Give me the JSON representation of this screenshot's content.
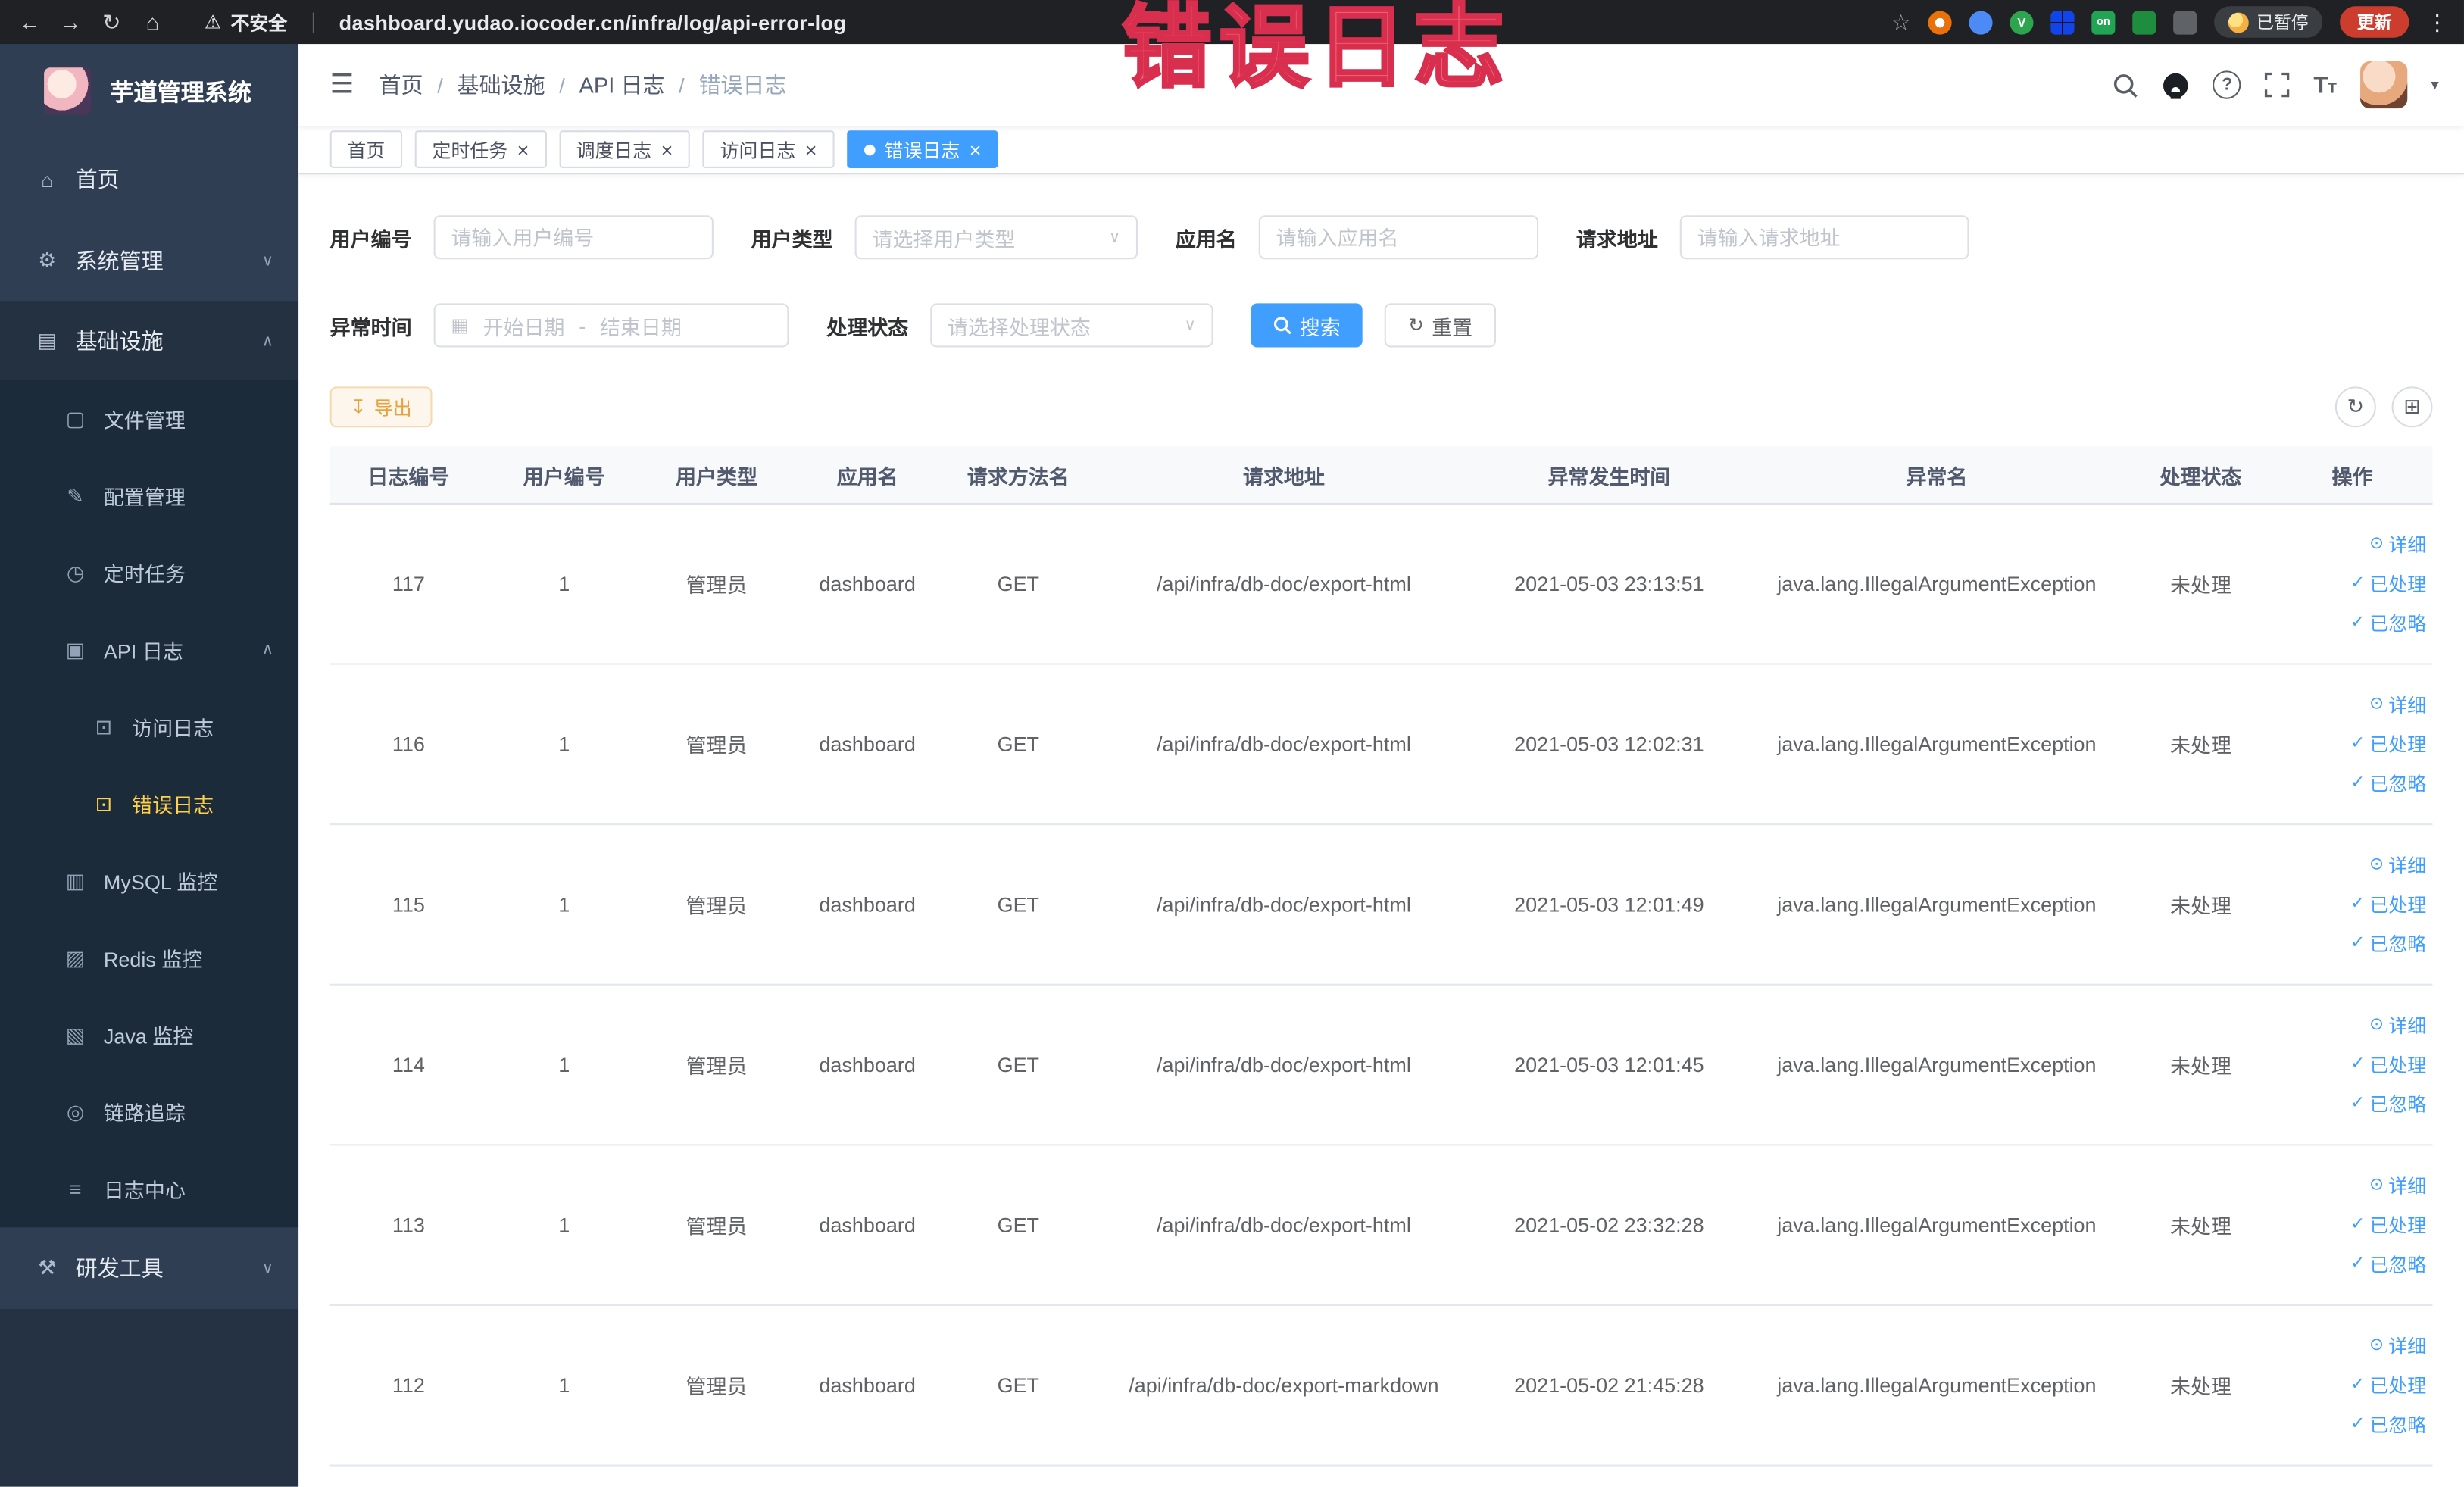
{
  "browser": {
    "security_label": "不安全",
    "url": "dashboard.yudao.iocoder.cn/infra/log/api-error-log",
    "paused_badge": "已暂停",
    "update_button": "更新"
  },
  "annotation_text": "错误日志",
  "icons": {
    "back": "←",
    "forward": "→",
    "reload": "↻",
    "home": "⌂",
    "warning": "⚠",
    "star": "☆",
    "overflow_menu": "⋮",
    "vue_badge": "V",
    "on_badge": "on",
    "hamburger": "☰",
    "breadcrumb_sep": "/",
    "chevron_down": "∨",
    "chevron_up": "∧",
    "select_arrow": "∨",
    "calendar": "▦",
    "refresh": "↻",
    "export": "↧",
    "close": "×",
    "detail": "⊙",
    "check": "✓",
    "caret_down": "▾",
    "help": "?",
    "font_size_large": "T",
    "font_size_small": "T",
    "columns": "⊞"
  },
  "colors": {
    "primary": "#409eff",
    "menu_active": "#ffd04b",
    "export_warning": "#e6a23c",
    "annotation": "#f25c74",
    "sidebar_bg": "#2f3e52",
    "chrome_bg": "#202124"
  },
  "sidebar": {
    "logo_title": "芋道管理系统",
    "menu": [
      {
        "label": "首页",
        "glyph": "⌂"
      },
      {
        "label": "系统管理",
        "glyph": "⚙"
      },
      {
        "label": "基础设施",
        "glyph": "▤"
      },
      {
        "label": "文件管理",
        "glyph": "▢"
      },
      {
        "label": "配置管理",
        "glyph": "✎"
      },
      {
        "label": "定时任务",
        "glyph": "◷"
      },
      {
        "label": "API 日志",
        "glyph": "▣"
      },
      {
        "label": "访问日志",
        "glyph": "⊡"
      },
      {
        "label": "错误日志",
        "glyph": "⊡"
      },
      {
        "label": "MySQL 监控",
        "glyph": "▥"
      },
      {
        "label": "Redis 监控",
        "glyph": "▨"
      },
      {
        "label": "Java 监控",
        "glyph": "▧"
      },
      {
        "label": "链路追踪",
        "glyph": "◎"
      },
      {
        "label": "日志中心",
        "glyph": "≡"
      },
      {
        "label": "研发工具",
        "glyph": "⚒"
      }
    ]
  },
  "header": {
    "breadcrumb": [
      "首页",
      "基础设施",
      "API 日志",
      "错误日志"
    ]
  },
  "tabs": [
    {
      "label": "首页"
    },
    {
      "label": "定时任务"
    },
    {
      "label": "调度日志"
    },
    {
      "label": "访问日志"
    },
    {
      "label": "错误日志"
    }
  ],
  "filters": {
    "user_id_label": "用户编号",
    "user_id_placeholder": "请输入用户编号",
    "user_type_label": "用户类型",
    "user_type_placeholder": "请选择用户类型",
    "app_name_label": "应用名",
    "app_name_placeholder": "请输入应用名",
    "request_url_label": "请求地址",
    "request_url_placeholder": "请输入请求地址",
    "time_label": "异常时间",
    "time_start_placeholder": "开始日期",
    "time_separator": "-",
    "time_end_placeholder": "结束日期",
    "status_label": "处理状态",
    "status_placeholder": "请选择处理状态",
    "search_button": "搜索",
    "reset_button": "重置"
  },
  "toolbar": {
    "export_button": "导出"
  },
  "table": {
    "columns": [
      "日志编号",
      "用户编号",
      "用户类型",
      "应用名",
      "请求方法名",
      "请求地址",
      "异常发生时间",
      "异常名",
      "处理状态",
      "操作"
    ],
    "row_actions": {
      "detail": "详细",
      "processed": "已处理",
      "ignored": "已忽略"
    },
    "rows": [
      {
        "log_id": "117",
        "user_id": "1",
        "user_type": "管理员",
        "app_name": "dashboard",
        "method": "GET",
        "url": "/api/infra/db-doc/export-html",
        "time": "2021-05-03 23:13:51",
        "exception": "java.lang.IllegalArgumentException",
        "status": "未处理"
      },
      {
        "log_id": "116",
        "user_id": "1",
        "user_type": "管理员",
        "app_name": "dashboard",
        "method": "GET",
        "url": "/api/infra/db-doc/export-html",
        "time": "2021-05-03 12:02:31",
        "exception": "java.lang.IllegalArgumentException",
        "status": "未处理"
      },
      {
        "log_id": "115",
        "user_id": "1",
        "user_type": "管理员",
        "app_name": "dashboard",
        "method": "GET",
        "url": "/api/infra/db-doc/export-html",
        "time": "2021-05-03 12:01:49",
        "exception": "java.lang.IllegalArgumentException",
        "status": "未处理"
      },
      {
        "log_id": "114",
        "user_id": "1",
        "user_type": "管理员",
        "app_name": "dashboard",
        "method": "GET",
        "url": "/api/infra/db-doc/export-html",
        "time": "2021-05-03 12:01:45",
        "exception": "java.lang.IllegalArgumentException",
        "status": "未处理"
      },
      {
        "log_id": "113",
        "user_id": "1",
        "user_type": "管理员",
        "app_name": "dashboard",
        "method": "GET",
        "url": "/api/infra/db-doc/export-html",
        "time": "2021-05-02 23:32:28",
        "exception": "java.lang.IllegalArgumentException",
        "status": "未处理"
      },
      {
        "log_id": "112",
        "user_id": "1",
        "user_type": "管理员",
        "app_name": "dashboard",
        "method": "GET",
        "url": "/api/infra/db-doc/export-markdown",
        "time": "2021-05-02 21:45:28",
        "exception": "java.lang.IllegalArgumentException",
        "status": "未处理"
      }
    ]
  }
}
